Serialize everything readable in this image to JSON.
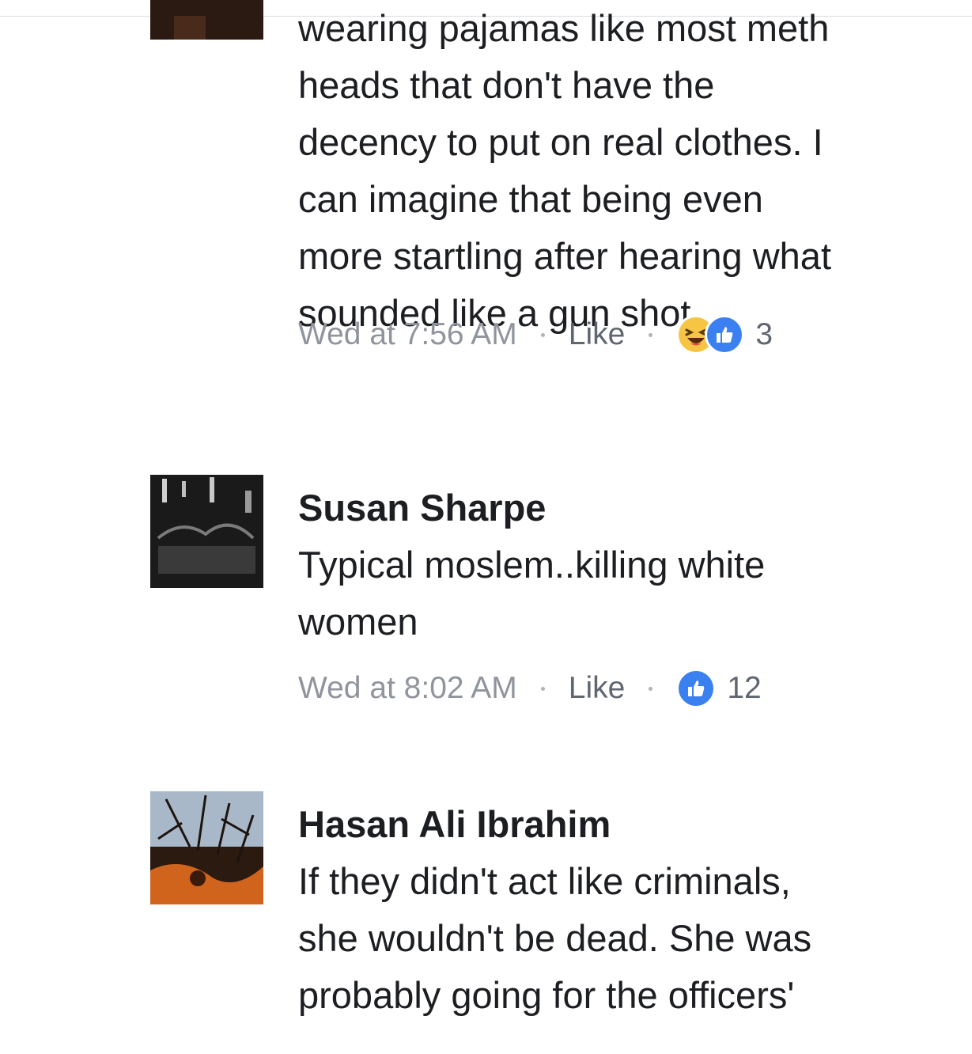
{
  "comments": [
    {
      "author": "",
      "text_lines": [
        "wearing pajamas like most meth",
        "heads that don't have the",
        "decency to put on real clothes. I",
        "can imagine that being even",
        "more startling after hearing what",
        "sounded like a gun shot."
      ],
      "timestamp": "Wed at 7:56 AM",
      "like_label": "Like",
      "reactions": [
        "haha-icon",
        "like-icon"
      ],
      "reaction_count": "3"
    },
    {
      "author": "Susan Sharpe",
      "text_lines": [
        "Typical moslem..killing white",
        "women"
      ],
      "timestamp": "Wed at 8:02 AM",
      "like_label": "Like",
      "reactions": [
        "like-icon"
      ],
      "reaction_count": "12"
    },
    {
      "author": "Hasan Ali Ibrahim",
      "text_lines": [
        "If they didn't act like criminals,",
        "she wouldn't be dead. She was",
        "probably going for the officers'"
      ]
    }
  ],
  "colors": {
    "like_blue": "#3a80f0",
    "haha_yellow": "#f7c544",
    "meta_gray": "#90949c"
  }
}
